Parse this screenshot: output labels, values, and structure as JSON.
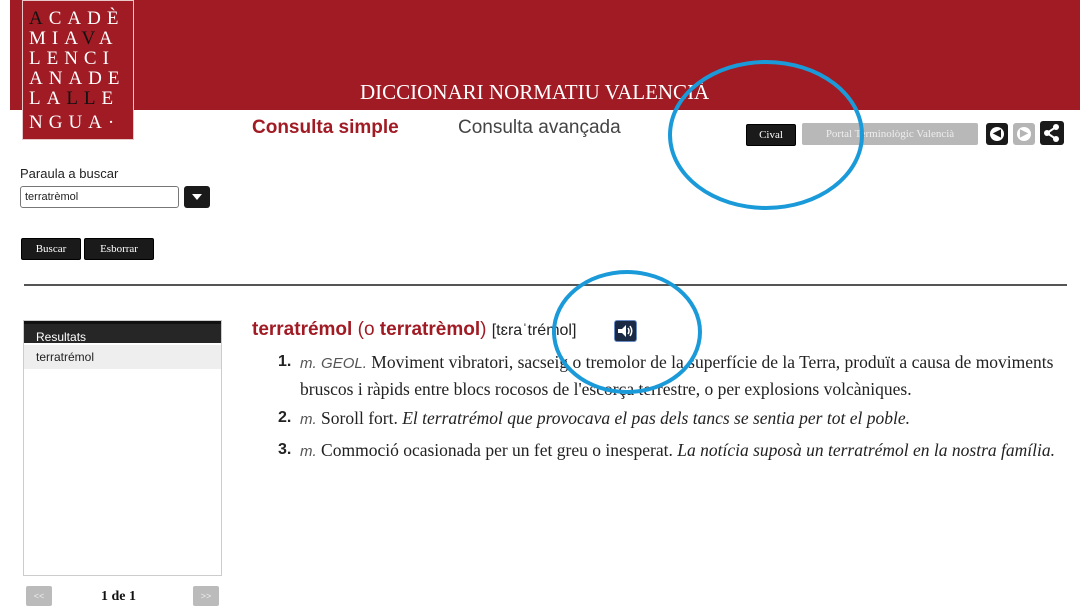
{
  "header": {
    "logo_rows": [
      [
        "A",
        "CADÈ"
      ],
      [
        "MIA",
        "V",
        "A"
      ],
      [
        "LENCI"
      ],
      [
        "ANADE"
      ],
      [
        "LA",
        "LL",
        "E"
      ],
      [
        "NGUA·"
      ]
    ],
    "site_title": "DICCIONARI NORMATIU VALENCIÀ"
  },
  "tabs": {
    "simple": "Consulta simple",
    "advanced": "Consulta avançada"
  },
  "toolbar": {
    "cival": "Cival",
    "portal": "Portal Terminològic Valencià",
    "back_icon": "back-arrow-icon",
    "forward_icon": "forward-arrow-icon",
    "share_icon": "share-icon"
  },
  "search": {
    "label": "Paraula a buscar",
    "value": "terratrèmol",
    "search_button": "Buscar",
    "clear_button": "Esborrar"
  },
  "results": {
    "header": "Resultats",
    "items": [
      "terratrémol"
    ],
    "prev": "<<",
    "next": ">>",
    "page_info": "1 de 1"
  },
  "entry": {
    "headword": "terratrémol",
    "open": " (",
    "or": "o",
    "alt_headword": "terratrèmol",
    "close": ")",
    "pronunciation": "[tɛraˈtrémol]",
    "definitions": [
      {
        "num": "1.",
        "gram": "m.",
        "field": "GEOL.",
        "text": "Moviment vibratori, sacseig o tremolor de la superfície de la Terra, produït a causa de moviments bruscos i ràpids entre blocs rocosos de l'escorça terrestre, o per explosions volcàniques.",
        "example": ""
      },
      {
        "num": "2.",
        "gram": "m.",
        "field": "",
        "text": "Soroll fort.",
        "example": "El terratrémol que provocava el pas dels tancs se sentia per tot el poble."
      },
      {
        "num": "3.",
        "gram": "m.",
        "field": "",
        "text": "Commoció ocasionada per un fet greu o inesperat.",
        "example": "La notícia suposà un terratrémol en la nostra família."
      }
    ]
  },
  "colors": {
    "brand": "#a11b24",
    "annotation": "#1a9ad9"
  }
}
